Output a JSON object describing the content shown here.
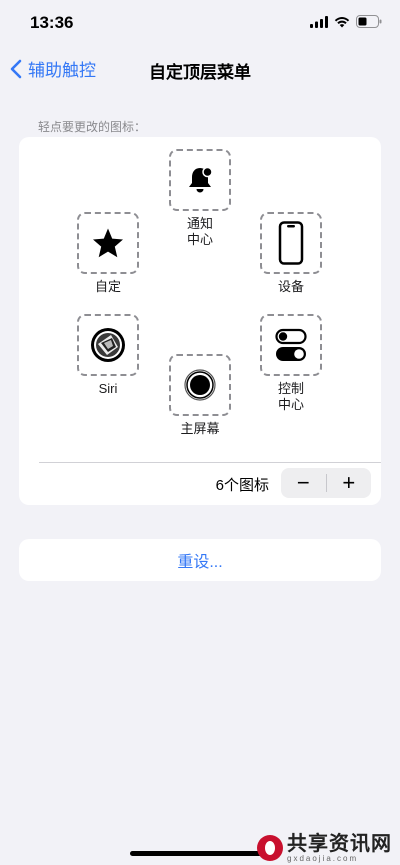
{
  "status": {
    "time": "13:36"
  },
  "nav": {
    "back_label": "辅助触控",
    "title": "自定顶层菜单"
  },
  "hint": "轻点要更改的图标：",
  "slots": [
    {
      "label": "通知\n中心",
      "icon": "bell-icon"
    },
    {
      "label": "设备",
      "icon": "iphone-icon"
    },
    {
      "label": "控制\n中心",
      "icon": "toggles-icon"
    },
    {
      "label": "主屏幕",
      "icon": "home-button-icon"
    },
    {
      "label": "Siri",
      "icon": "siri-icon"
    },
    {
      "label": "自定",
      "icon": "star-icon"
    }
  ],
  "count": {
    "label": "6个图标",
    "minus": "−",
    "plus": "+"
  },
  "reset": {
    "label": "重设..."
  },
  "watermark": {
    "main": "共享资讯网",
    "sub": "gxdaojia.com"
  },
  "colors": {
    "accent": "#3478f6",
    "background": "#f2f2f7",
    "card": "#ffffff"
  }
}
